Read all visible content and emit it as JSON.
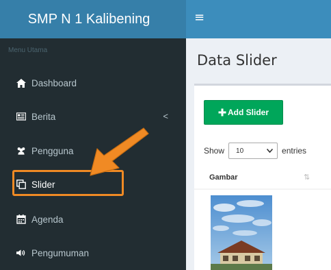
{
  "brand": "SMP N 1 Kalibening",
  "sidebar": {
    "header": "Menu Utama",
    "items": [
      {
        "label": "Dashboard",
        "icon": "home-icon"
      },
      {
        "label": "Berita",
        "icon": "newspaper-icon",
        "has_submenu": true
      },
      {
        "label": "Pengguna",
        "icon": "users-icon"
      },
      {
        "label": "Slider",
        "icon": "slider-icon",
        "highlighted": true
      },
      {
        "label": "Agenda",
        "icon": "calendar-icon"
      },
      {
        "label": "Pengumuman",
        "icon": "megaphone-icon"
      }
    ]
  },
  "topbar": {
    "menu_icon": "≡"
  },
  "page": {
    "title": "Data Slider"
  },
  "toolbar": {
    "add_label": "Add Slider"
  },
  "table_controls": {
    "show_label": "Show",
    "entries_value": "10",
    "entries_label": "entries"
  },
  "table": {
    "columns": [
      "Gambar"
    ]
  },
  "colors": {
    "brand": "#367fa9",
    "topbar": "#3c8dbc",
    "sidebar": "#222d32",
    "add_button": "#00a65a",
    "highlight": "#f08a24"
  }
}
